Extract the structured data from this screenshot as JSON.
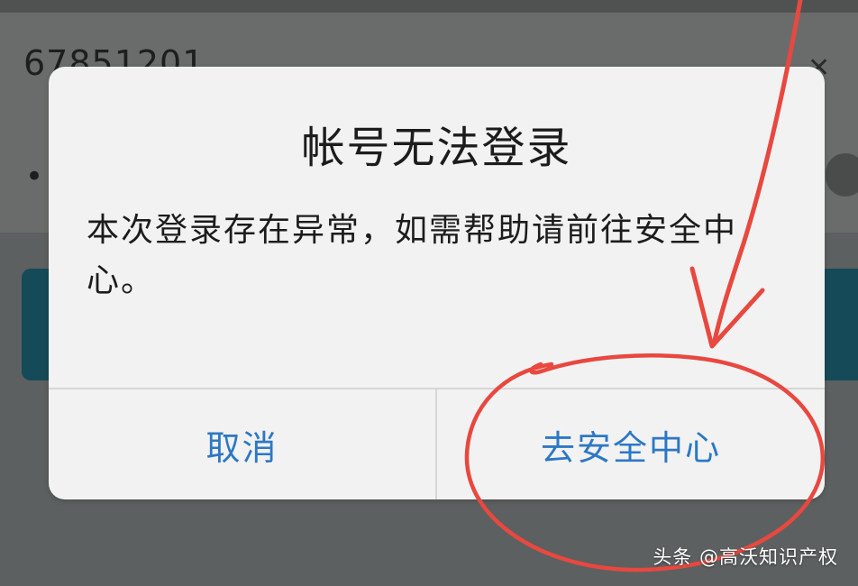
{
  "background": {
    "account_partial": "67851201",
    "password_mask": "•••",
    "clear_icon": "close-icon"
  },
  "dialog": {
    "title": "帐号无法登录",
    "message": "本次登录存在异常，如需帮助请前往安全中心。",
    "cancel_label": "取消",
    "go_label": "去安全中心",
    "button_color": "#2d78c4"
  },
  "annotation": {
    "color": "#e8483f",
    "shapes": [
      "arrow",
      "circle"
    ]
  },
  "watermark": "头条 @高沃知识产权"
}
